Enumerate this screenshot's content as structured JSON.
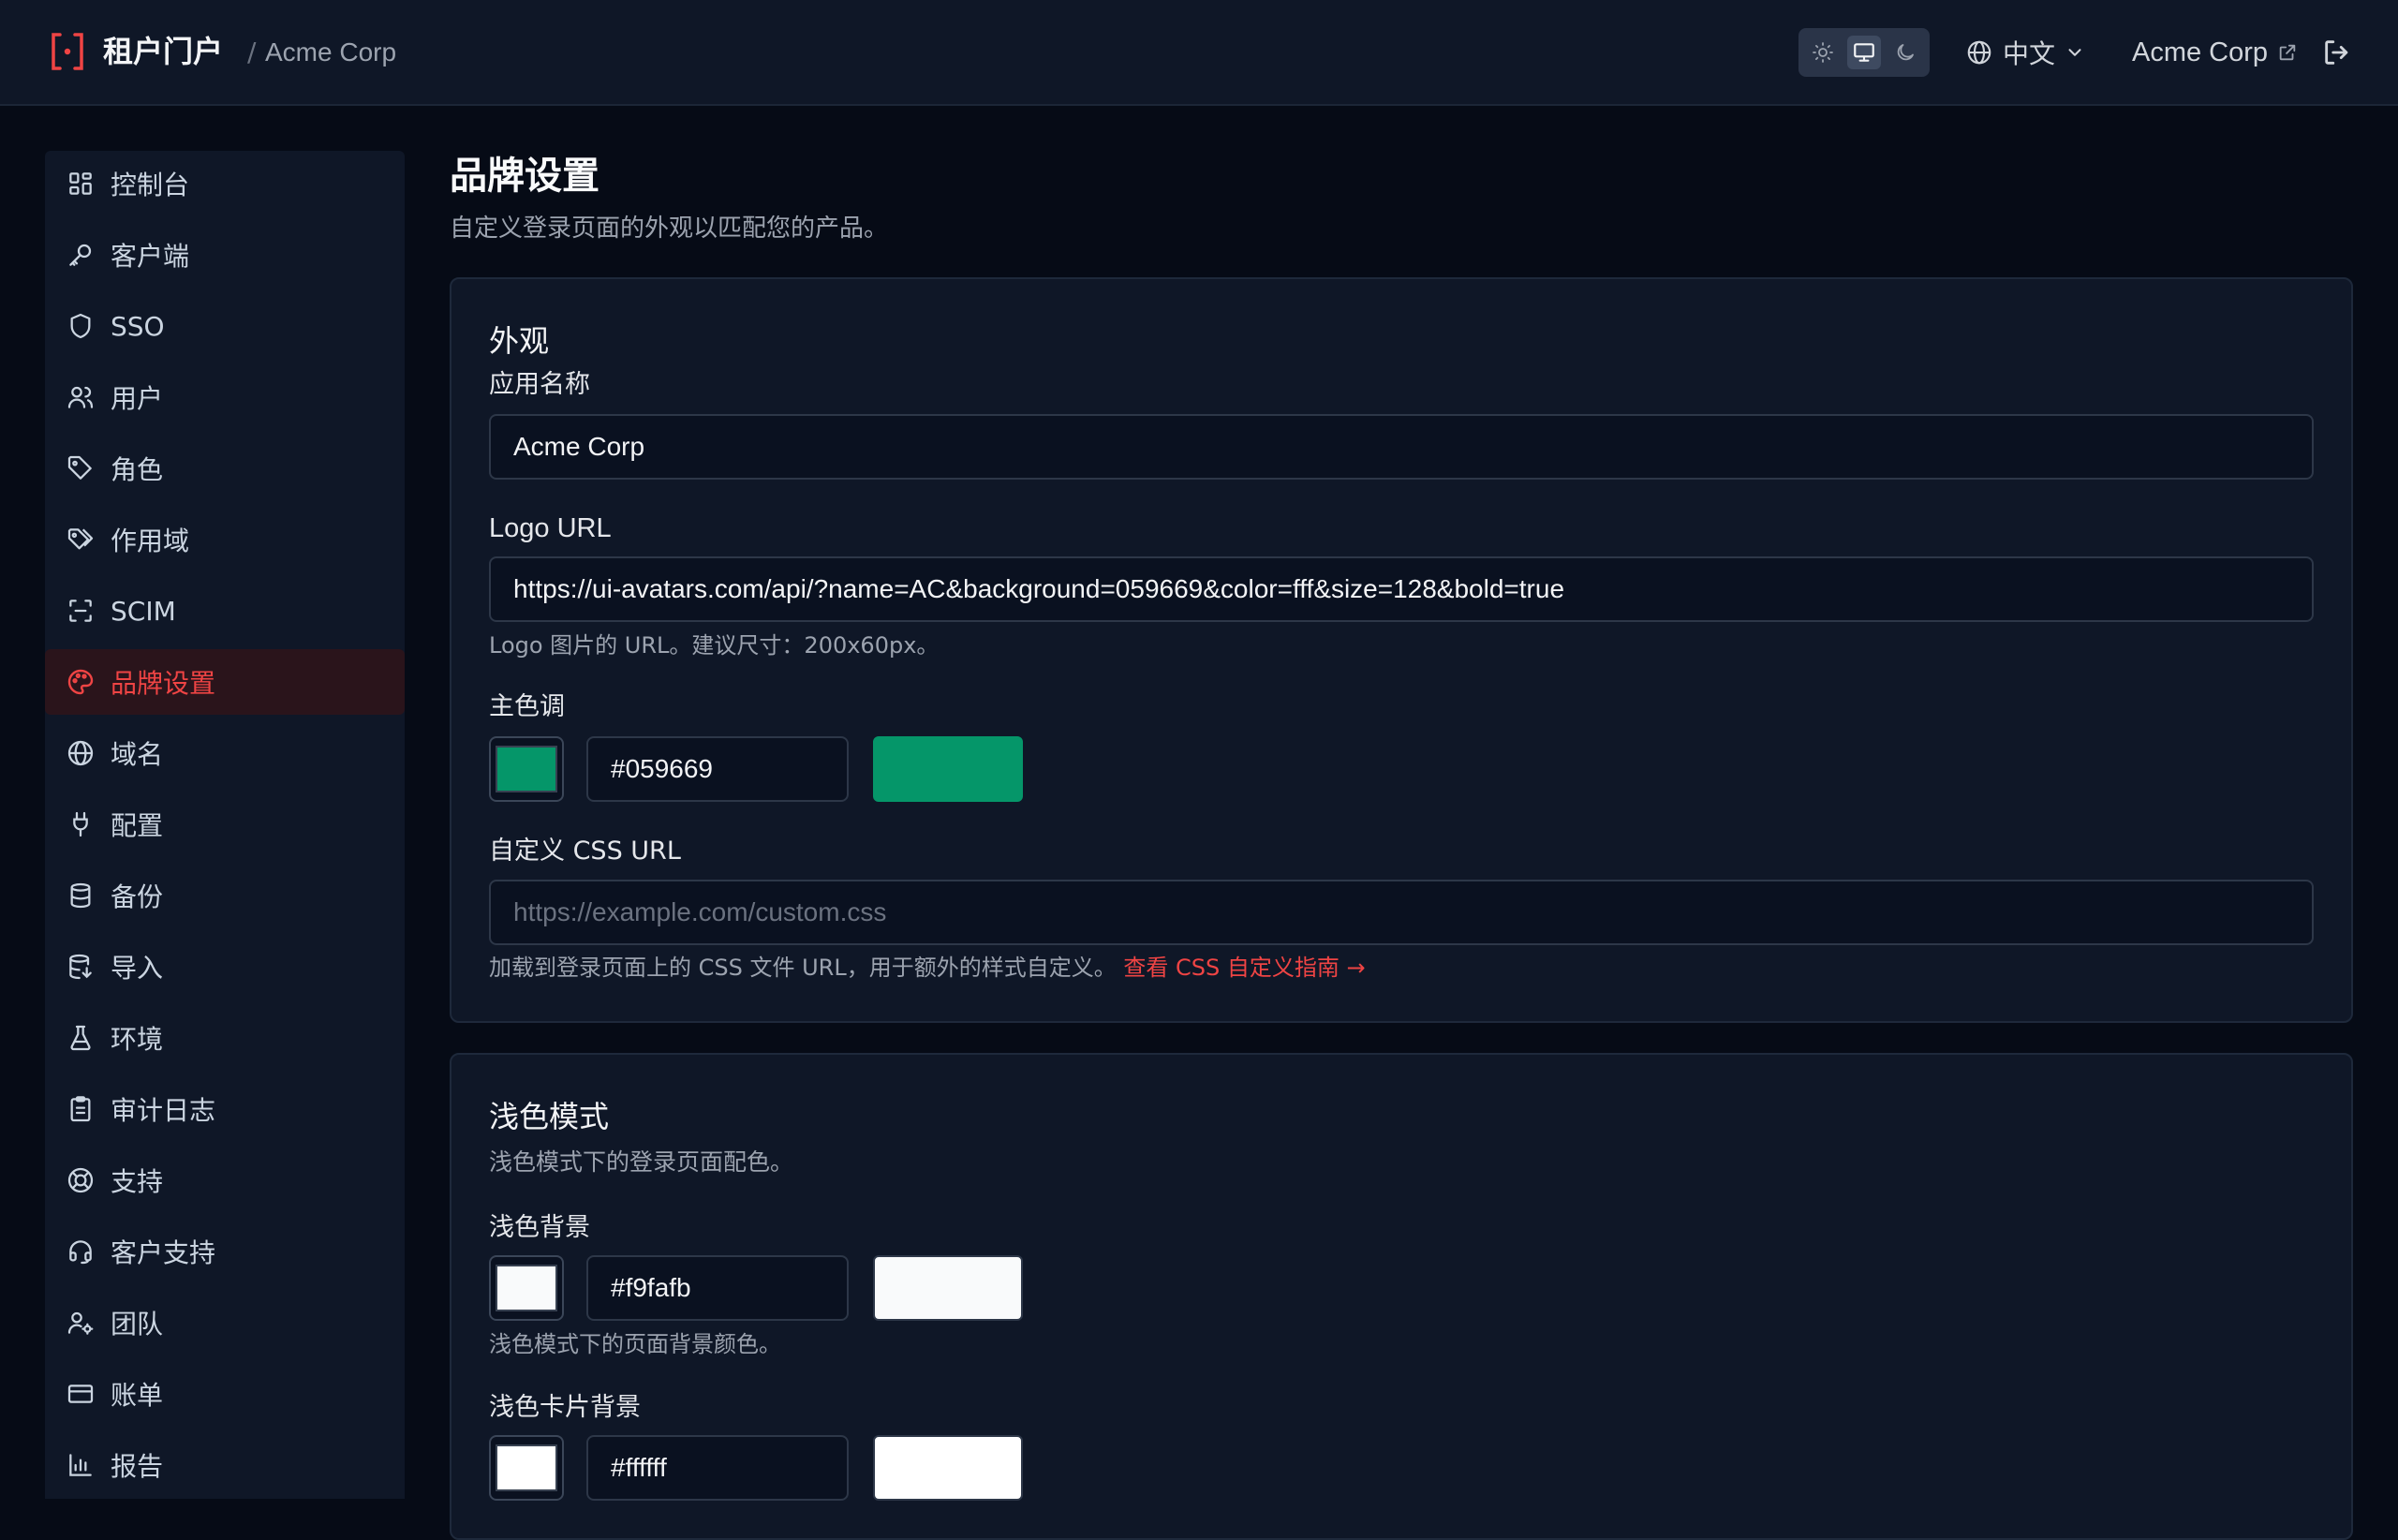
{
  "header": {
    "title": "租户门户",
    "separator": "/",
    "tenant": "Acme Corp",
    "language": "中文",
    "tenant_link": "Acme Corp"
  },
  "sidebar": {
    "items": [
      {
        "label": "控制台",
        "icon": "dashboard-icon"
      },
      {
        "label": "客户端",
        "icon": "key-icon"
      },
      {
        "label": "SSO",
        "icon": "shield-icon"
      },
      {
        "label": "用户",
        "icon": "users-icon"
      },
      {
        "label": "角色",
        "icon": "tag-icon"
      },
      {
        "label": "作用域",
        "icon": "tags-icon"
      },
      {
        "label": "SCIM",
        "icon": "scan-icon"
      },
      {
        "label": "品牌设置",
        "icon": "palette-icon",
        "active": true
      },
      {
        "label": "域名",
        "icon": "globe-icon"
      },
      {
        "label": "配置",
        "icon": "plug-icon"
      },
      {
        "label": "备份",
        "icon": "database-icon"
      },
      {
        "label": "导入",
        "icon": "database-import-icon"
      },
      {
        "label": "环境",
        "icon": "flask-icon"
      },
      {
        "label": "审计日志",
        "icon": "clipboard-icon"
      },
      {
        "label": "支持",
        "icon": "lifebuoy-icon"
      },
      {
        "label": "客户支持",
        "icon": "headset-icon"
      },
      {
        "label": "团队",
        "icon": "user-cog-icon"
      },
      {
        "label": "账单",
        "icon": "credit-card-icon"
      },
      {
        "label": "报告",
        "icon": "bar-chart-icon"
      }
    ]
  },
  "page": {
    "title": "品牌设置",
    "subtitle": "自定义登录页面的外观以匹配您的产品。"
  },
  "appearance": {
    "title": "外观",
    "app_name_label": "应用名称",
    "app_name_value": "Acme Corp",
    "logo_label": "Logo URL",
    "logo_value": "https://ui-avatars.com/api/?name=AC&background=059669&color=fff&size=128&bold=true",
    "logo_help": "Logo 图片的 URL。建议尺寸：200x60px。",
    "primary_label": "主色调",
    "primary_hex": "#059669",
    "primary_color": "#059669",
    "css_label": "自定义 CSS URL",
    "css_placeholder": "https://example.com/custom.css",
    "css_help": "加载到登录页面上的 CSS 文件 URL，用于额外的样式自定义。",
    "css_help_link": "查看 CSS 自定义指南 →"
  },
  "light_mode": {
    "title": "浅色模式",
    "subtitle": "浅色模式下的登录页面配色。",
    "bg_label": "浅色背景",
    "bg_hex": "#f9fafb",
    "bg_color": "#f9fafb",
    "bg_help": "浅色模式下的页面背景颜色。",
    "card_label": "浅色卡片背景",
    "card_hex": "#ffffff",
    "card_color": "#ffffff"
  },
  "colors": {
    "accent": "#ef4444",
    "background": "#060b16",
    "panel": "#0f1727"
  }
}
